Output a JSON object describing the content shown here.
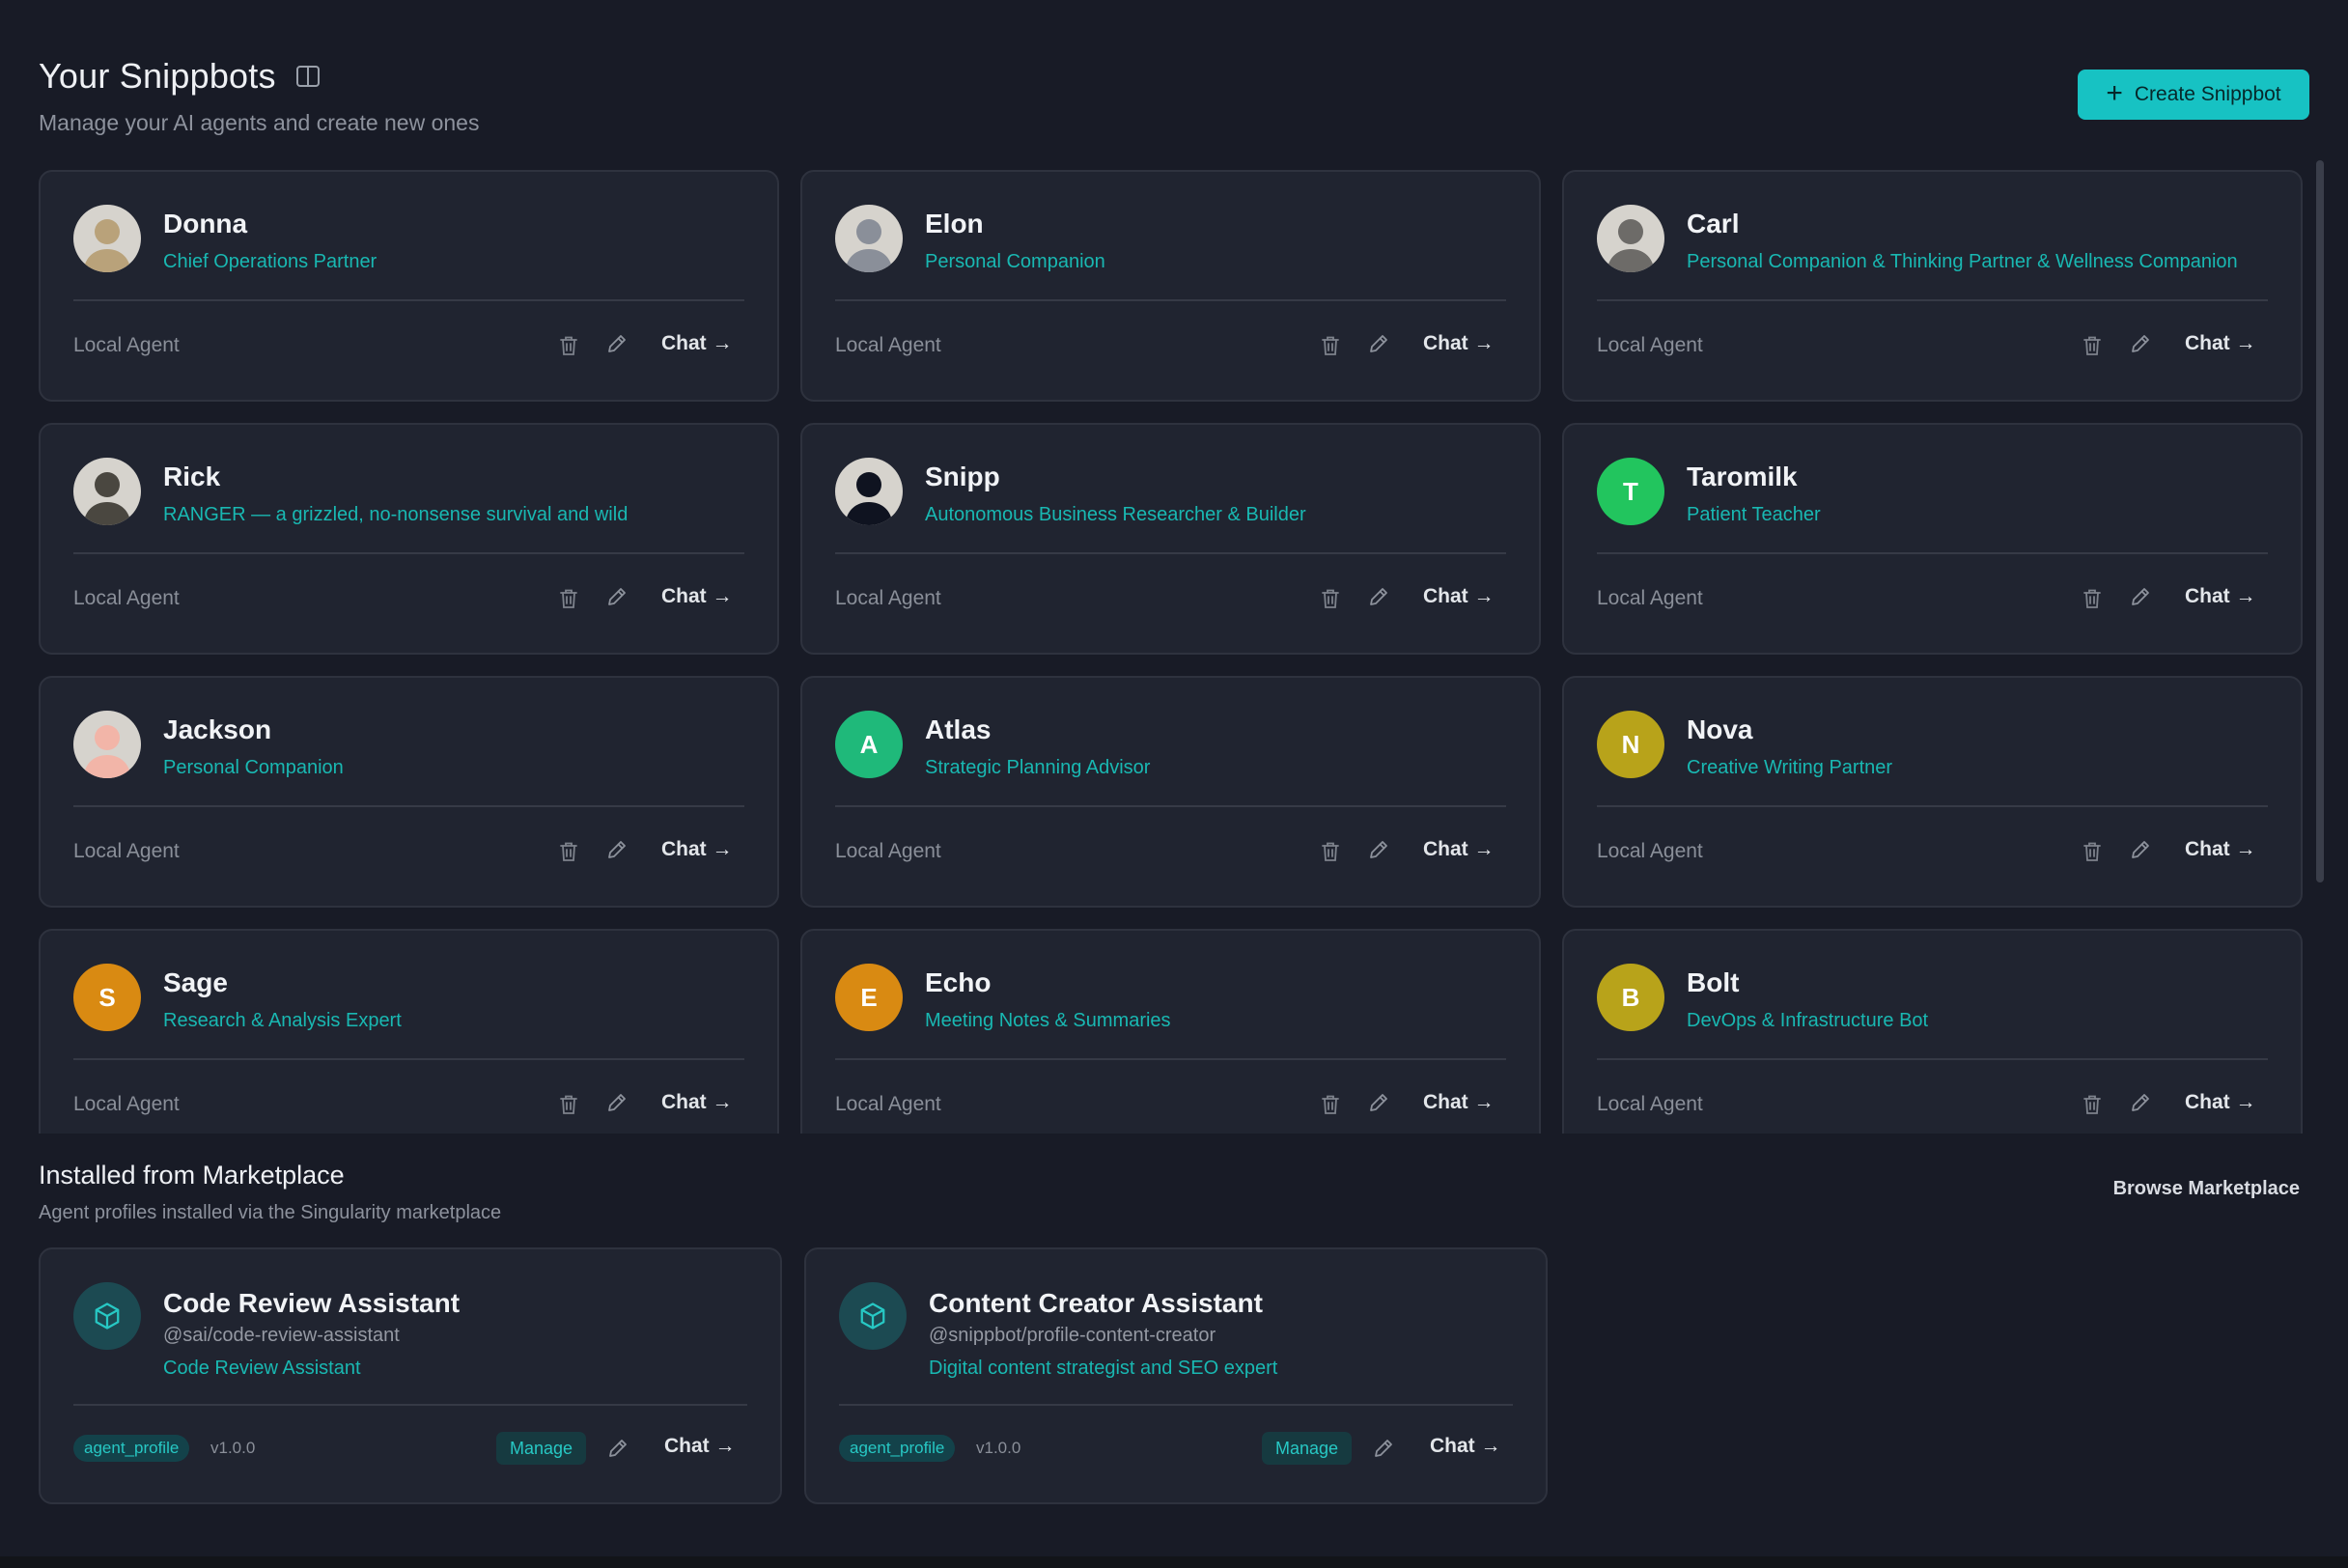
{
  "header": {
    "title": "Your Snippbots",
    "subtitle": "Manage your AI agents and create new ones",
    "create_button": "Create Snippbot",
    "icons": {
      "panel": "sidebar-panel-icon",
      "plus": "plus-icon"
    }
  },
  "agents": [
    {
      "name": "Donna",
      "role": "Chief Operations Partner",
      "footer": "Local Agent",
      "chat": "Chat →",
      "avatar": {
        "type": "photo",
        "color": "#b9a27a"
      }
    },
    {
      "name": "Elon",
      "role": "Personal Companion",
      "footer": "Local Agent",
      "chat": "Chat →",
      "avatar": {
        "type": "photo",
        "color": "#8a8f99"
      }
    },
    {
      "name": "Carl",
      "role": "Personal Companion & Thinking Partner & Wellness Companion",
      "footer": "Local Agent",
      "chat": "Chat →",
      "avatar": {
        "type": "photo",
        "color": "#6d6b68"
      }
    },
    {
      "name": "Rick",
      "role": "RANGER — a grizzled, no-nonsense survival and wild",
      "footer": "Local Agent",
      "chat": "Chat →",
      "avatar": {
        "type": "photo",
        "color": "#4a4740"
      }
    },
    {
      "name": "Snipp",
      "role": "Autonomous Business Researcher & Builder",
      "footer": "Local Agent",
      "chat": "Chat →",
      "avatar": {
        "type": "photo",
        "color": "#0f1320"
      }
    },
    {
      "name": "Taromilk",
      "role": "Patient Teacher",
      "footer": "Local Agent",
      "chat": "Chat →",
      "avatar": {
        "type": "initial",
        "initial": "T",
        "color": "#22c55e"
      }
    },
    {
      "name": "Jackson",
      "role": "Personal Companion",
      "footer": "Local Agent",
      "chat": "Chat →",
      "avatar": {
        "type": "photo",
        "color": "#f2b5a8"
      }
    },
    {
      "name": "Atlas",
      "role": "Strategic Planning Advisor",
      "footer": "Local Agent",
      "chat": "Chat →",
      "avatar": {
        "type": "initial",
        "initial": "A",
        "color": "#1fb97a"
      }
    },
    {
      "name": "Nova",
      "role": "Creative Writing Partner",
      "footer": "Local Agent",
      "chat": "Chat →",
      "avatar": {
        "type": "initial",
        "initial": "N",
        "color": "#b8a31a"
      }
    },
    {
      "name": "Sage",
      "role": "Research & Analysis Expert",
      "footer": "Local Agent",
      "chat": "Chat →",
      "avatar": {
        "type": "initial",
        "initial": "S",
        "color": "#d98a12"
      }
    },
    {
      "name": "Echo",
      "role": "Meeting Notes & Summaries",
      "footer": "Local Agent",
      "chat": "Chat →",
      "avatar": {
        "type": "initial",
        "initial": "E",
        "color": "#d98a12"
      }
    },
    {
      "name": "Bolt",
      "role": "DevOps & Infrastructure Bot",
      "footer": "Local Agent",
      "chat": "Chat →",
      "avatar": {
        "type": "initial",
        "initial": "B",
        "color": "#b8a31a"
      }
    }
  ],
  "marketplace": {
    "title": "Installed from Marketplace",
    "subtitle": "Agent profiles installed via the Singularity marketplace",
    "browse": "Browse Marketplace",
    "items": [
      {
        "name": "Code Review Assistant",
        "handle": "@sai/code-review-assistant",
        "role": "Code Review Assistant",
        "tag": "agent_profile",
        "version": "v1.0.0",
        "manage": "Manage",
        "chat": "Chat →"
      },
      {
        "name": "Content Creator Assistant",
        "handle": "@snippbot/profile-content-creator",
        "role": "Digital content strategist and SEO expert",
        "tag": "agent_profile",
        "version": "v1.0.0",
        "manage": "Manage",
        "chat": "Chat →"
      }
    ]
  }
}
